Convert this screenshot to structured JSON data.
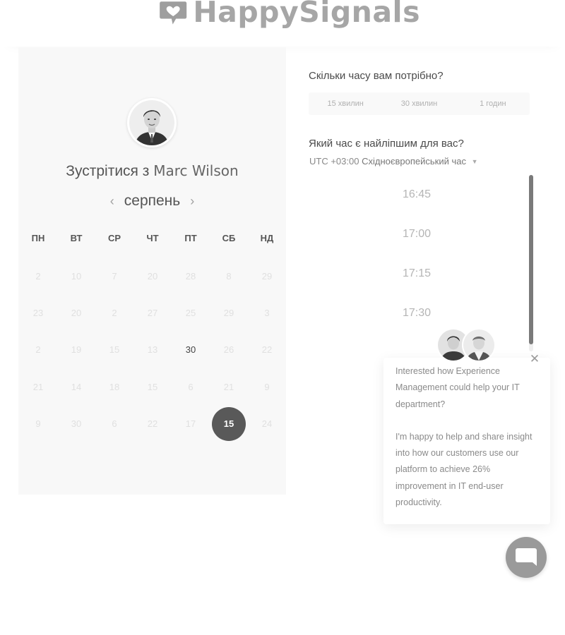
{
  "brand": {
    "name": "HappySignals",
    "logo_icon": "heart-speech-bubble-icon",
    "color": "#a6a6a6"
  },
  "scheduler": {
    "title_prefix": "Зустрітися з",
    "host_name": "Marc Wilson",
    "month": "серпень",
    "weekdays": [
      "ПН",
      "ВТ",
      "СР",
      "ЧТ",
      "ПТ",
      "СБ",
      "НД"
    ],
    "days": [
      {
        "label": "2",
        "state": "disabled"
      },
      {
        "label": "10",
        "state": "disabled"
      },
      {
        "label": "7",
        "state": "disabled"
      },
      {
        "label": "20",
        "state": "disabled"
      },
      {
        "label": "28",
        "state": "disabled"
      },
      {
        "label": "8",
        "state": "disabled"
      },
      {
        "label": "29",
        "state": "disabled"
      },
      {
        "label": "23",
        "state": "disabled"
      },
      {
        "label": "20",
        "state": "disabled"
      },
      {
        "label": "2",
        "state": "disabled"
      },
      {
        "label": "27",
        "state": "disabled"
      },
      {
        "label": "25",
        "state": "disabled"
      },
      {
        "label": "29",
        "state": "disabled"
      },
      {
        "label": "3",
        "state": "disabled"
      },
      {
        "label": "2",
        "state": "disabled"
      },
      {
        "label": "19",
        "state": "disabled"
      },
      {
        "label": "15",
        "state": "disabled"
      },
      {
        "label": "13",
        "state": "disabled"
      },
      {
        "label": "30",
        "state": "active"
      },
      {
        "label": "26",
        "state": "disabled"
      },
      {
        "label": "22",
        "state": "disabled"
      },
      {
        "label": "21",
        "state": "disabled"
      },
      {
        "label": "14",
        "state": "disabled"
      },
      {
        "label": "18",
        "state": "disabled"
      },
      {
        "label": "15",
        "state": "disabled"
      },
      {
        "label": "6",
        "state": "disabled"
      },
      {
        "label": "21",
        "state": "disabled"
      },
      {
        "label": "9",
        "state": "disabled"
      },
      {
        "label": "9",
        "state": "disabled"
      },
      {
        "label": "30",
        "state": "disabled"
      },
      {
        "label": "6",
        "state": "disabled"
      },
      {
        "label": "22",
        "state": "disabled"
      },
      {
        "label": "17",
        "state": "disabled"
      },
      {
        "label": "15",
        "state": "selected"
      },
      {
        "label": "24",
        "state": "disabled"
      }
    ]
  },
  "duration": {
    "question": "Скільки часу вам потрібно?",
    "options": [
      "15 хвилин",
      "30 хвилин",
      "1 годин"
    ]
  },
  "time": {
    "question": "Який час є найліпшим для вас?",
    "timezone_offset": "UTC +03:00",
    "timezone_name": "Східноєвропейський час",
    "slots": [
      "16:45",
      "17:00",
      "17:15",
      "17:30"
    ]
  },
  "chat": {
    "message_1": "Interested how Experience Management could help your IT department?",
    "message_2": "I'm happy to help and share insight into how our customers use our platform to achieve 26% improvement in IT end-user productivity.",
    "launcher_icon": "chat-bubble-icon",
    "close_icon": "close-icon"
  }
}
